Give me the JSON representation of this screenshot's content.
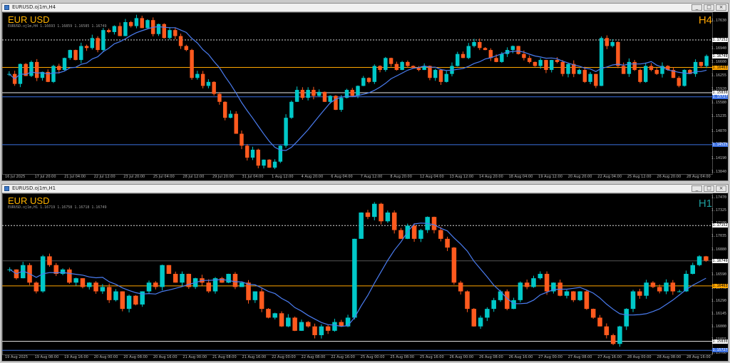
{
  "windows": [
    {
      "title": "EURUSD.oj1m,H4",
      "symbol": "EUR USD",
      "timeframe": "H4",
      "tf_color": "#ffa500",
      "ohlc_line": "EURUSD.oj1m,H4  1.16693 1.16859 1.16585 1.16749",
      "price_ticks": [
        "1.17630",
        "1.17155",
        "1.16940",
        "1.16600",
        "1.16255",
        "1.15920",
        "1.15580",
        "1.15235",
        "1.14870",
        "1.14545",
        "1.14190",
        "1.13840"
      ],
      "price_labels": [
        {
          "text": "1.17152",
          "bg": "#ffffff",
          "fg": "#000000",
          "price": 1.17152
        },
        {
          "text": "1.16749",
          "bg": "#ffffff",
          "fg": "#000000",
          "price": 1.16749
        },
        {
          "text": "1.16463",
          "bg": "#ffa500",
          "fg": "#000000",
          "price": 1.16463
        },
        {
          "text": "1.15830",
          "bg": "#ffffff",
          "fg": "#000000",
          "price": 1.1583
        },
        {
          "text": "1.15727",
          "bg": "#3b6fe0",
          "fg": "#ffffff",
          "price": 1.15727
        },
        {
          "text": "1.14525",
          "bg": "#3b6fe0",
          "fg": "#ffffff",
          "price": 1.14525
        }
      ],
      "time_ticks": [
        "16 Jul 2025",
        "17 Jul 20:00",
        "21 Jul 04:00",
        "22 Jul 12:00",
        "23 Jul 20:00",
        "25 Jul 04:00",
        "28 Jul 12:00",
        "29 Jul 20:00",
        "31 Jul 04:00",
        "1 Aug 12:00",
        "4 Aug 20:00",
        "6 Aug 04:00",
        "7 Aug 12:00",
        "8 Aug 20:00",
        "12 Aug 04:00",
        "13 Aug 12:00",
        "14 Aug 20:00",
        "18 Aug 04:00",
        "19 Aug 12:00",
        "20 Aug 20:00",
        "22 Aug 04:00",
        "25 Aug 12:00",
        "26 Aug 20:00",
        "28 Aug 04:00"
      ],
      "chart_data": {
        "type": "candlestick",
        "ylim": [
          1.1379,
          1.1785
        ],
        "bull_color": "#00c8c8",
        "bear_color": "#ff5a1e",
        "ma_color": "#4a7cf0",
        "levels": [
          {
            "price": 1.17152,
            "style": "dotted",
            "color": "#d8d8d8"
          },
          {
            "price": 1.16463,
            "style": "solid",
            "color": "#ffa500"
          },
          {
            "price": 1.1583,
            "style": "solid",
            "color": "#e8e8e8"
          },
          {
            "price": 1.15727,
            "style": "solid",
            "color": "#3b6fe0"
          },
          {
            "price": 1.14525,
            "style": "solid",
            "color": "#3b6fe0"
          }
        ],
        "path": [
          1.163,
          1.1605,
          1.1655,
          1.1625,
          1.166,
          1.162,
          1.1635,
          1.161,
          1.165,
          1.164,
          1.167,
          1.169,
          1.1665,
          1.17,
          1.1695,
          1.172,
          1.169,
          1.174,
          1.1735,
          1.175,
          1.1725,
          1.176,
          1.175,
          1.177,
          1.1745,
          1.1765,
          1.173,
          1.1755,
          1.172,
          1.174,
          1.1725,
          1.17,
          1.169,
          1.162,
          1.163,
          1.16,
          1.161,
          1.158,
          1.156,
          1.152,
          1.153,
          1.148,
          1.145,
          1.142,
          1.144,
          1.14,
          1.1415,
          1.1395,
          1.141,
          1.145,
          1.152,
          1.156,
          1.159,
          1.157,
          1.159,
          1.1575,
          1.1585,
          1.156,
          1.1575,
          1.154,
          1.157,
          1.159,
          1.1575,
          1.16,
          1.162,
          1.161,
          1.165,
          1.164,
          1.167,
          1.1655,
          1.164,
          1.166,
          1.165,
          1.1645,
          1.164,
          1.165,
          1.162,
          1.164,
          1.161,
          1.163,
          1.165,
          1.168,
          1.167,
          1.17,
          1.171,
          1.1695,
          1.169,
          1.167,
          1.166,
          1.168,
          1.169,
          1.17,
          1.168,
          1.167,
          1.166,
          1.165,
          1.1665,
          1.164,
          1.1665,
          1.166,
          1.163,
          1.1655,
          1.163,
          1.164,
          1.161,
          1.163,
          1.16,
          1.172,
          1.17,
          1.171,
          1.165,
          1.163,
          1.166,
          1.164,
          1.161,
          1.165,
          1.164,
          1.163,
          1.165,
          1.164,
          1.162,
          1.16,
          1.164,
          1.163,
          1.166,
          1.165,
          1.1675
        ]
      }
    },
    {
      "title": "EURUSD.oj1m,H1",
      "symbol": "EUR USD",
      "timeframe": "H1",
      "tf_color": "#1e9e9e",
      "ohlc_line": "EURUSD.oj1m,H1  1.16719 1.16758 1.16718 1.16749",
      "price_ticks": [
        "1.17470",
        "1.17325",
        "1.17180",
        "1.17035",
        "1.16880",
        "1.16735",
        "1.16590",
        "1.16440",
        "1.16290",
        "1.16145",
        "1.16000",
        "1.15855",
        "1.15700"
      ],
      "price_labels": [
        {
          "text": "1.17152",
          "bg": "#ffffff",
          "fg": "#000000",
          "price": 1.17152
        },
        {
          "text": "1.16749",
          "bg": "#ffffff",
          "fg": "#000000",
          "price": 1.16749
        },
        {
          "text": "1.16463",
          "bg": "#ffa500",
          "fg": "#000000",
          "price": 1.16463
        },
        {
          "text": "1.15830",
          "bg": "#ffffff",
          "fg": "#000000",
          "price": 1.1583
        },
        {
          "text": "1.15727",
          "bg": "#3b6fe0",
          "fg": "#ffffff",
          "price": 1.15727
        }
      ],
      "time_ticks": [
        "19 Aug 2025",
        "19 Aug 08:00",
        "19 Aug 16:00",
        "20 Aug 00:00",
        "20 Aug 08:00",
        "20 Aug 16:00",
        "21 Aug 00:00",
        "21 Aug 08:00",
        "21 Aug 16:00",
        "22 Aug 00:00",
        "22 Aug 08:00",
        "22 Aug 16:00",
        "25 Aug 00:00",
        "25 Aug 08:00",
        "25 Aug 16:00",
        "26 Aug 00:00",
        "26 Aug 08:00",
        "26 Aug 16:00",
        "27 Aug 00:00",
        "27 Aug 08:00",
        "27 Aug 16:00",
        "28 Aug 00:00",
        "28 Aug 08:00",
        "28 Aug 16:00"
      ],
      "chart_data": {
        "type": "candlestick",
        "ylim": [
          1.1568,
          1.1752
        ],
        "bull_color": "#00c8c8",
        "bear_color": "#ff5a1e",
        "ma_color": "#4a7cf0",
        "levels": [
          {
            "price": 1.17152,
            "style": "dotted",
            "color": "#d8d8d8"
          },
          {
            "price": 1.16749,
            "style": "solid",
            "color": "#555555"
          },
          {
            "price": 1.16463,
            "style": "solid",
            "color": "#ffa500"
          },
          {
            "price": 1.1583,
            "style": "solid",
            "color": "#e8e8e8"
          },
          {
            "price": 1.15727,
            "style": "solid",
            "color": "#3b6fe0"
          }
        ],
        "path": [
          1.1665,
          1.1655,
          1.167,
          1.165,
          1.164,
          1.168,
          1.167,
          1.166,
          1.1665,
          1.165,
          1.1655,
          1.1645,
          1.165,
          1.164,
          1.1645,
          1.163,
          1.164,
          1.162,
          1.1635,
          1.1625,
          1.164,
          1.165,
          1.1645,
          1.167,
          1.166,
          1.165,
          1.166,
          1.1645,
          1.1655,
          1.165,
          1.164,
          1.1655,
          1.165,
          1.166,
          1.1645,
          1.165,
          1.163,
          1.164,
          1.162,
          1.161,
          1.1615,
          1.16,
          1.161,
          1.1595,
          1.1605,
          1.16,
          1.159,
          1.16,
          1.1595,
          1.1605,
          1.16,
          1.161,
          1.17,
          1.173,
          1.1725,
          1.174,
          1.172,
          1.173,
          1.171,
          1.17,
          1.1715,
          1.17,
          1.171,
          1.1725,
          1.171,
          1.17,
          1.169,
          1.165,
          1.164,
          1.162,
          1.16,
          1.161,
          1.162,
          1.163,
          1.164,
          1.162,
          1.163,
          1.165,
          1.1645,
          1.1655,
          1.166,
          1.164,
          1.165,
          1.1635,
          1.164,
          1.163,
          1.164,
          1.162,
          1.161,
          1.16,
          1.159,
          1.158,
          1.16,
          1.162,
          1.164,
          1.1635,
          1.165,
          1.1645,
          1.164,
          1.165,
          1.164,
          1.164,
          1.166,
          1.167,
          1.168,
          1.1675
        ]
      }
    }
  ],
  "window_buttons": [
    "_",
    "□",
    "×"
  ]
}
